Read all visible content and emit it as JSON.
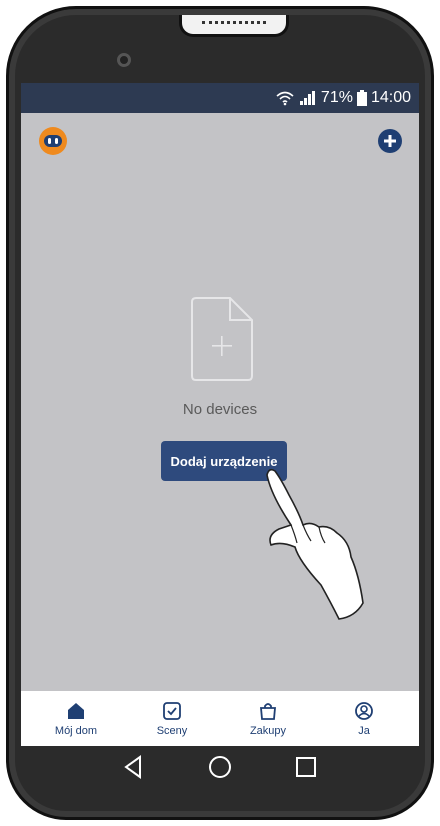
{
  "status_bar": {
    "battery": "71%",
    "time": "14:00"
  },
  "main": {
    "empty_text": "No devices",
    "add_device_label": "Dodaj urządzenie"
  },
  "tabs": [
    {
      "label": "Mój dom",
      "icon": "home-icon"
    },
    {
      "label": "Sceny",
      "icon": "checkbox-icon"
    },
    {
      "label": "Zakupy",
      "icon": "shopping-bag-icon"
    },
    {
      "label": "Ja",
      "icon": "user-circle-icon"
    }
  ],
  "colors": {
    "primary": "#2e4a7d",
    "status_bar": "#2d3a52",
    "screen_bg": "#c3c3c6",
    "avatar": "#ef8a1e"
  }
}
